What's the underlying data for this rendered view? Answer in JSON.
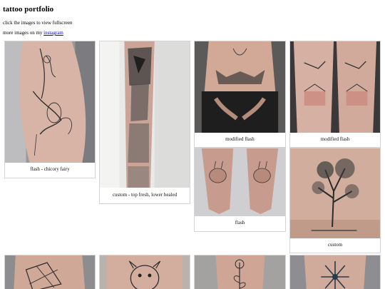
{
  "header": {
    "title": "tattoo portfolio",
    "intro": "click the images to view fullscreen",
    "more_prefix": "more images on my ",
    "instagram_link": "instagram"
  },
  "gallery": {
    "items": [
      {
        "caption": "flash - chicory fairy",
        "photo": "thigh-fairy-tattoo-photo"
      },
      {
        "caption": "custom - top fresh, lower healed",
        "photo": "forearm-sleeve-tattoo-photo"
      },
      {
        "caption": "modified flash",
        "photo": "chest-bunny-tattoo-photo"
      },
      {
        "caption": "modified flash",
        "photo": "thighs-bunny-tattoo-photo"
      },
      {
        "caption": "flash",
        "photo": "hands-bunny-tattoo-photo"
      },
      {
        "caption": "custom",
        "photo": "back-tree-tattoo-photo"
      },
      {
        "caption": "",
        "photo": "geometric-tattoo-photo"
      },
      {
        "caption": "",
        "photo": "dog-portrait-tattoo-photo"
      },
      {
        "caption": "",
        "photo": "floral-tattoo-photo"
      },
      {
        "caption": "",
        "photo": "snowflake-tattoo-photo"
      }
    ]
  },
  "colors": {
    "link": "#0000ee",
    "card_border": "#d5d5d5",
    "skin": "#c9a696",
    "ink": "#2a2a2a"
  }
}
